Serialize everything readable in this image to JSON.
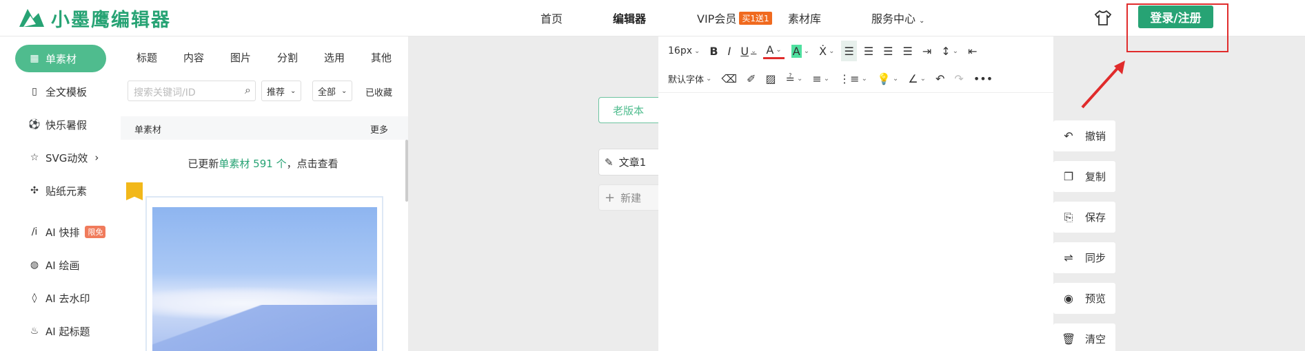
{
  "app": {
    "logo_text": "小墨鹰编辑器"
  },
  "nav": {
    "home": "首页",
    "editor": "编辑器",
    "vip": "VIP会员",
    "vip_badge": "买1送1",
    "materials": "素材库",
    "service": "服务中心",
    "login": "登录/注册"
  },
  "sidebar": {
    "items": [
      {
        "label": "单素材",
        "icon": "grid-icon"
      },
      {
        "label": "全文模板",
        "icon": "template-icon"
      },
      {
        "label": "快乐暑假",
        "icon": "soccer-ball-icon"
      },
      {
        "label": "SVG动效",
        "icon": "star-icon"
      },
      {
        "label": "贴纸元素",
        "icon": "puzzle-icon"
      },
      {
        "label": "AI 快排",
        "icon": "ai-icon",
        "badge": "限免"
      },
      {
        "label": "AI 绘画",
        "icon": "palette-icon"
      },
      {
        "label": "AI 去水印",
        "icon": "drop-icon"
      },
      {
        "label": "AI 起标题",
        "icon": "flame-icon"
      }
    ]
  },
  "panel": {
    "tabs": [
      "标题",
      "内容",
      "图片",
      "分割",
      "选用",
      "其他"
    ],
    "search_placeholder": "搜索关键词/ID",
    "sort_label": "推荐",
    "filter_label": "全部",
    "favorites": "已收藏",
    "section_title": "单素材",
    "more": "更多",
    "notice_prefix": "已更新",
    "notice_highlight": "单素材 591 个",
    "notice_suffix": "，点击查看"
  },
  "docs": {
    "old_version": "老版本",
    "article": "文章1",
    "new": "新建"
  },
  "toolbar": {
    "font_size": "16px",
    "font_family": "默认字体"
  },
  "ops": [
    "撤销",
    "复制",
    "保存",
    "同步",
    "预览",
    "清空"
  ],
  "colors": {
    "brand": "#27a374",
    "highlight": "#e02b2b"
  }
}
